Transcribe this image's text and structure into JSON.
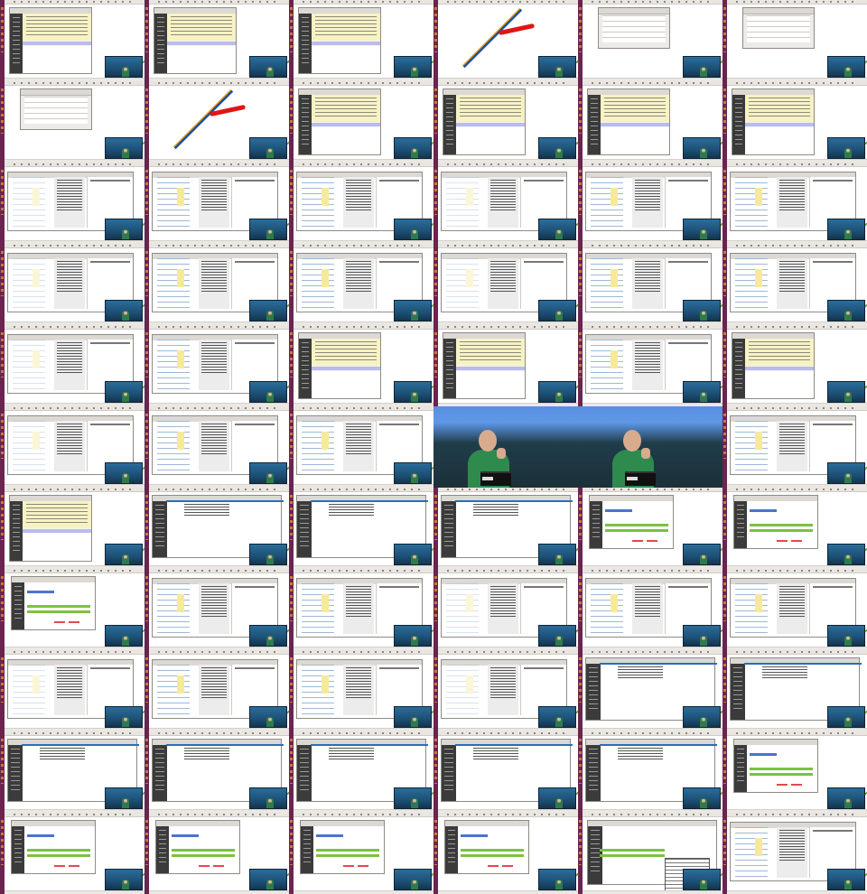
{
  "grid": {
    "columns": 6,
    "rows": 11
  },
  "thumbnails": [
    {
      "kind": "window"
    },
    {
      "kind": "window"
    },
    {
      "kind": "window"
    },
    {
      "kind": "lines"
    },
    {
      "kind": "dialog"
    },
    {
      "kind": "dialog"
    },
    {
      "kind": "dialog"
    },
    {
      "kind": "lines"
    },
    {
      "kind": "window"
    },
    {
      "kind": "window"
    },
    {
      "kind": "window"
    },
    {
      "kind": "window"
    },
    {
      "kind": "editor"
    },
    {
      "kind": "editor"
    },
    {
      "kind": "editor"
    },
    {
      "kind": "editor"
    },
    {
      "kind": "editor"
    },
    {
      "kind": "editor"
    },
    {
      "kind": "editor"
    },
    {
      "kind": "editor"
    },
    {
      "kind": "editor"
    },
    {
      "kind": "editor"
    },
    {
      "kind": "editor"
    },
    {
      "kind": "editor"
    },
    {
      "kind": "editor"
    },
    {
      "kind": "editor"
    },
    {
      "kind": "window"
    },
    {
      "kind": "window"
    },
    {
      "kind": "editor"
    },
    {
      "kind": "window"
    },
    {
      "kind": "editor"
    },
    {
      "kind": "editor"
    },
    {
      "kind": "editor"
    },
    {
      "kind": "camera"
    },
    {
      "kind": "camera"
    },
    {
      "kind": "editor"
    },
    {
      "kind": "window"
    },
    {
      "kind": "text"
    },
    {
      "kind": "text"
    },
    {
      "kind": "text"
    },
    {
      "kind": "progress"
    },
    {
      "kind": "progress"
    },
    {
      "kind": "progress"
    },
    {
      "kind": "editor"
    },
    {
      "kind": "editor"
    },
    {
      "kind": "editor"
    },
    {
      "kind": "editor"
    },
    {
      "kind": "editor"
    },
    {
      "kind": "editor"
    },
    {
      "kind": "editor"
    },
    {
      "kind": "editor"
    },
    {
      "kind": "editor"
    },
    {
      "kind": "text"
    },
    {
      "kind": "text"
    },
    {
      "kind": "text"
    },
    {
      "kind": "text"
    },
    {
      "kind": "text"
    },
    {
      "kind": "text"
    },
    {
      "kind": "text"
    },
    {
      "kind": "progress"
    },
    {
      "kind": "progress"
    },
    {
      "kind": "progress"
    },
    {
      "kind": "progress"
    },
    {
      "kind": "progress"
    },
    {
      "kind": "popup"
    },
    {
      "kind": "editor"
    }
  ],
  "colors": {
    "desktop": "#5a1e3c",
    "highlight_yellow": "#f7f2c4",
    "selection_row": "#b9bcef",
    "progress_green": "#7cc142",
    "line_red": "#e01515",
    "line_orange": "#d97c1f",
    "line_blue": "#1f3f8e"
  },
  "icons": {
    "sidebar": "launcher-icon-strip",
    "webcam": "presenter-video-inset"
  }
}
